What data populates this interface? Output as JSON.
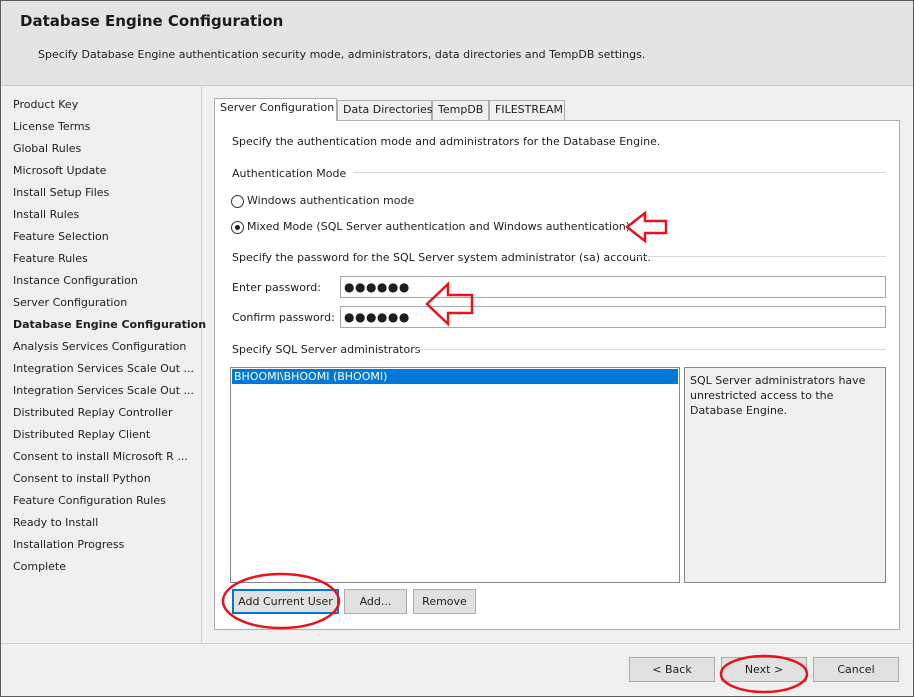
{
  "header": {
    "title": "Database Engine Configuration",
    "subtitle": "Specify Database Engine authentication security mode, administrators, data directories and TempDB settings."
  },
  "nav": {
    "items": [
      {
        "label": "Product Key"
      },
      {
        "label": "License Terms"
      },
      {
        "label": "Global Rules"
      },
      {
        "label": "Microsoft Update"
      },
      {
        "label": "Install Setup Files"
      },
      {
        "label": "Install Rules"
      },
      {
        "label": "Feature Selection"
      },
      {
        "label": "Feature Rules"
      },
      {
        "label": "Instance Configuration"
      },
      {
        "label": "Server Configuration"
      },
      {
        "label": "Database Engine Configuration",
        "active": true
      },
      {
        "label": "Analysis Services Configuration"
      },
      {
        "label": "Integration Services Scale Out ..."
      },
      {
        "label": "Integration Services Scale Out ..."
      },
      {
        "label": "Distributed Replay Controller"
      },
      {
        "label": "Distributed Replay Client"
      },
      {
        "label": "Consent to install Microsoft R ..."
      },
      {
        "label": "Consent to install Python"
      },
      {
        "label": "Feature Configuration Rules"
      },
      {
        "label": "Ready to Install"
      },
      {
        "label": "Installation Progress"
      },
      {
        "label": "Complete"
      }
    ]
  },
  "tabs": {
    "server_config": "Server Configuration",
    "data_dirs": "Data Directories",
    "tempdb": "TempDB",
    "filestream": "FILESTREAM",
    "active": "Server Configuration"
  },
  "server_config": {
    "intro": "Specify the authentication mode and administrators for the Database Engine.",
    "auth_mode_heading": "Authentication Mode",
    "windows_auth_label": "Windows authentication mode",
    "mixed_mode_label": "Mixed Mode (SQL Server authentication and Windows authentication)",
    "selected_mode": "Mixed Mode",
    "password_heading": "Specify the password for the SQL Server system administrator (sa) account.",
    "enter_password_label": "Enter password:",
    "enter_password_value": "●●●●●●",
    "confirm_password_label": "Confirm password:",
    "confirm_password_value": "●●●●●●",
    "admins_heading": "Specify SQL Server administrators",
    "admins": [
      "BHOOMI\\BHOOMI (BHOOMI)"
    ],
    "admins_info": "SQL Server administrators have unrestricted access to the Database Engine.",
    "add_current_user_label": "Add Current User",
    "add_label": "Add...",
    "remove_label": "Remove"
  },
  "footer": {
    "back_label": "< Back",
    "next_label": "Next >",
    "cancel_label": "Cancel"
  },
  "colors": {
    "annotation_red": "#e8141b",
    "selection_blue": "#0078d7"
  }
}
